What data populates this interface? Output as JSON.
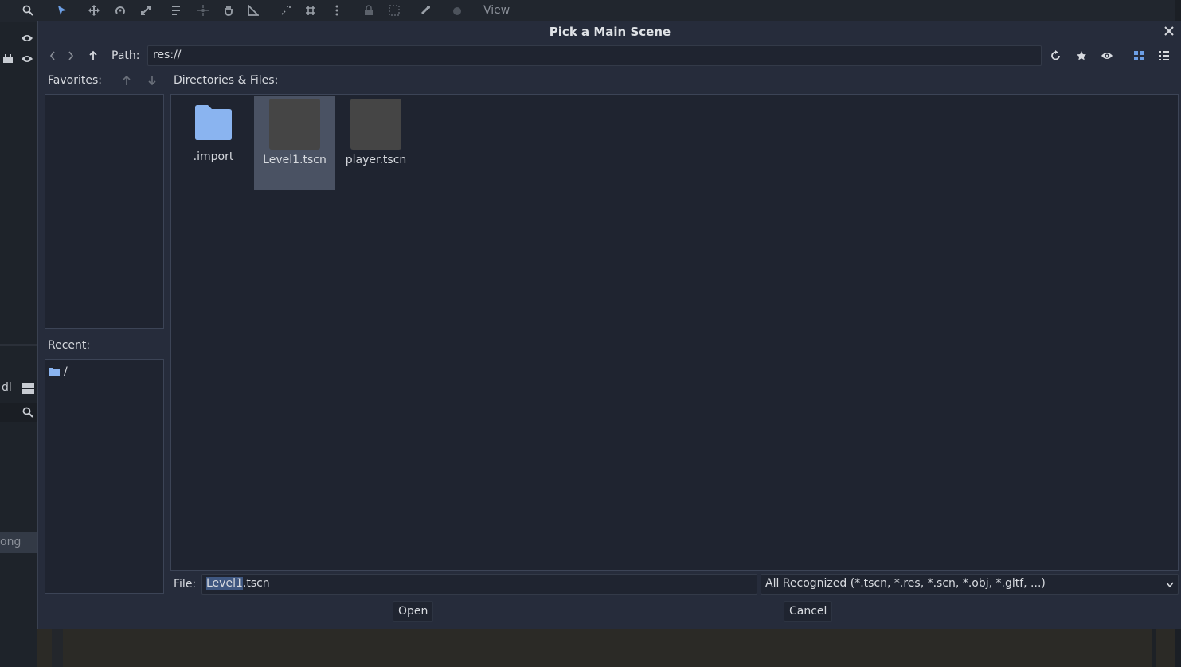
{
  "colors": {
    "accent": "#6d9fe5",
    "folder": "#8ab4f0",
    "dialog_bg": "#262c3b",
    "panel_bg": "#1f2430",
    "selected_bg": "#4a5263"
  },
  "editor": {
    "toolbar_view_label": "View",
    "side_partial_label": "dl",
    "side_partial_label2": "ong"
  },
  "dialog": {
    "title": "Pick a Main Scene",
    "path_label": "Path:",
    "path_value": "res://",
    "favorites_label": "Favorites:",
    "recent_label": "Recent:",
    "recent_items": [
      "/"
    ],
    "files_label": "Directories & Files:",
    "files": [
      {
        "name": ".import",
        "kind": "folder",
        "selected": false
      },
      {
        "name": "Level1.tscn",
        "kind": "scene",
        "selected": true
      },
      {
        "name": "player.tscn",
        "kind": "scene",
        "selected": false
      }
    ],
    "file_label": "File:",
    "file_value_highlight": "Level1",
    "file_value_rest": ".tscn",
    "filter_value": "All Recognized (*.tscn, *.res, *.scn, *.obj, *.gltf, ...)",
    "open_label": "Open",
    "cancel_label": "Cancel"
  }
}
